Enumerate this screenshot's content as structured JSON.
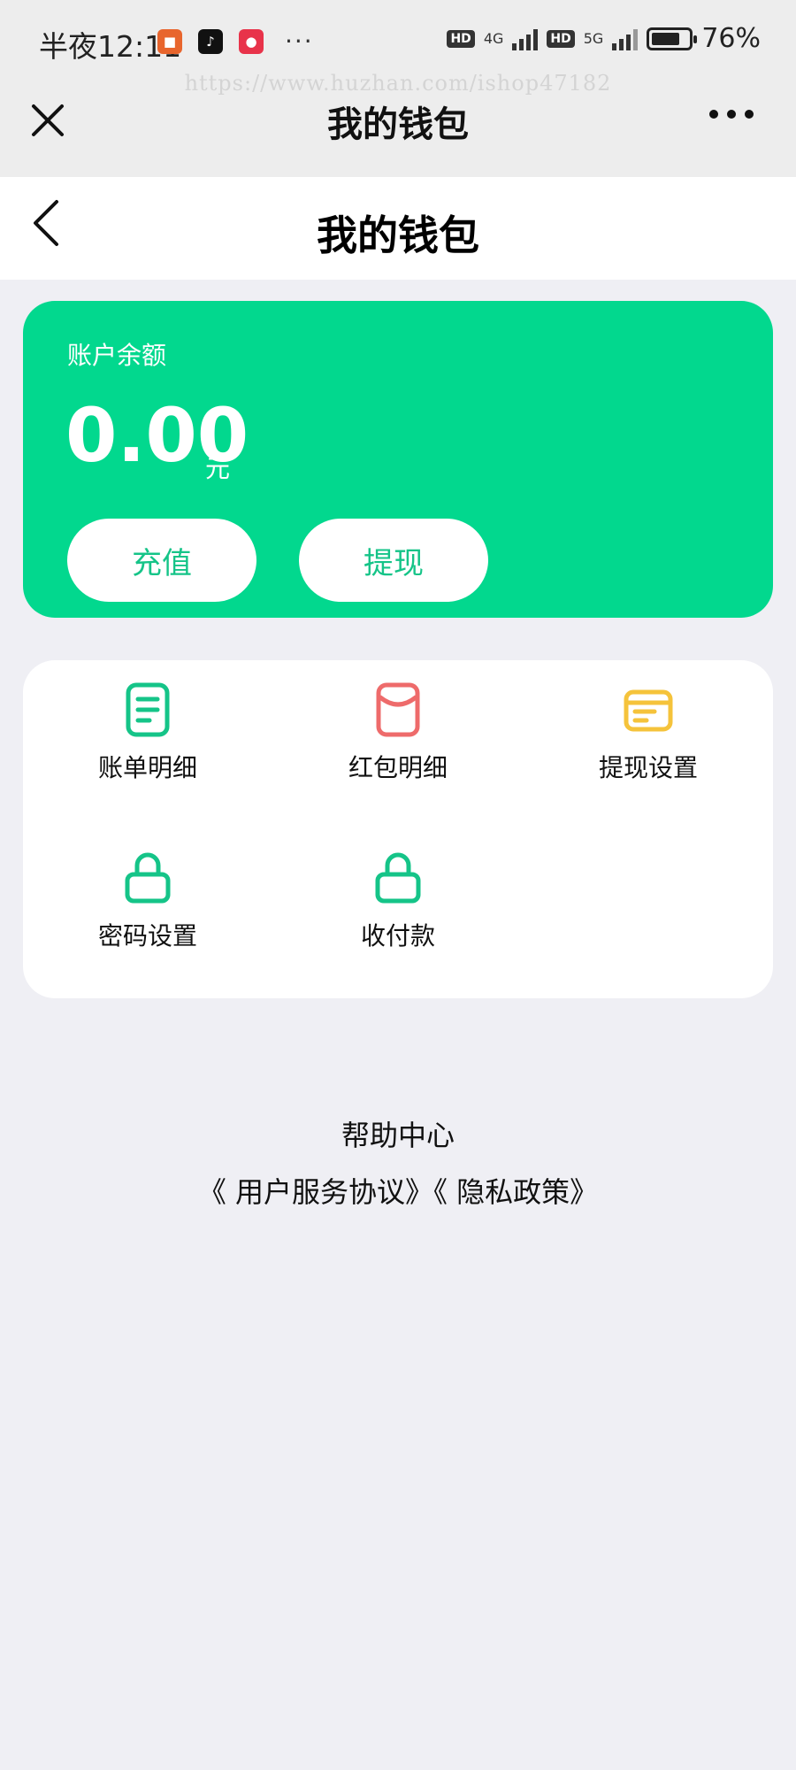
{
  "status_bar": {
    "time": "半夜12:11",
    "dots": "···",
    "net1": "4G",
    "net2": "5G",
    "hd": "HD",
    "battery": "76%",
    "battery_level": 0.76
  },
  "watermark": "https://www.huzhan.com/ishop47182",
  "host_bar": {
    "title": "我的钱包",
    "close_icon": "close-icon",
    "more_icon": "more-icon"
  },
  "page_header": {
    "title": "我的钱包",
    "back_icon": "chevron-left-icon"
  },
  "balance_card": {
    "label": "账户余额",
    "amount": "0.00",
    "unit": "元",
    "recharge_label": "充值",
    "withdraw_label": "提现",
    "color": "#02d88e"
  },
  "menu": {
    "items": [
      {
        "label": "账单明细",
        "icon": "document-icon",
        "color": "#15c488"
      },
      {
        "label": "红包明细",
        "icon": "red-envelope-icon",
        "color": "#ee6b6b"
      },
      {
        "label": "提现设置",
        "icon": "card-icon",
        "color": "#f5c33b"
      },
      {
        "label": "密码设置",
        "icon": "lock-icon",
        "color": "#15c488"
      },
      {
        "label": "收付款",
        "icon": "lock-icon",
        "color": "#15c488"
      }
    ]
  },
  "footer": {
    "help": "帮助中心",
    "agreement": "《 用户服务协议》",
    "privacy": "《 隐私政策》"
  }
}
